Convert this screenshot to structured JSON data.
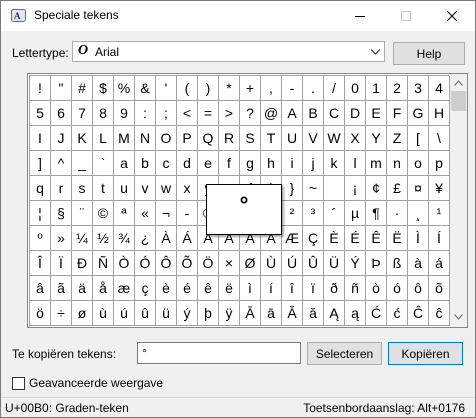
{
  "window": {
    "title": "Speciale tekens",
    "icons": {
      "app": "character-map-icon",
      "minimize": "minimize-icon",
      "maximize": "maximize-icon",
      "close": "close-icon"
    }
  },
  "font": {
    "label": "Lettertype:",
    "value": "Arial",
    "type_icon": "O",
    "help_label": "Help"
  },
  "grid": {
    "rows": [
      [
        "!",
        "\"",
        "#",
        "$",
        "%",
        "&",
        "'",
        "(",
        ")",
        "*",
        "+",
        ",",
        "-",
        ".",
        "/",
        "0",
        "1",
        "2",
        "3",
        "4"
      ],
      [
        "5",
        "6",
        "7",
        "8",
        "9",
        ":",
        ";",
        "<",
        "=",
        ">",
        "?",
        "@",
        "A",
        "B",
        "C",
        "D",
        "E",
        "F",
        "G",
        "H"
      ],
      [
        "I",
        "J",
        "K",
        "L",
        "M",
        "N",
        "O",
        "P",
        "Q",
        "R",
        "S",
        "T",
        "U",
        "V",
        "W",
        "X",
        "Y",
        "Z",
        "[",
        "\\"
      ],
      [
        "]",
        "^",
        "_",
        "`",
        "a",
        "b",
        "c",
        "d",
        "e",
        "f",
        "g",
        "h",
        "i",
        "j",
        "k",
        "l",
        "m",
        "n",
        "o",
        "p"
      ],
      [
        "q",
        "r",
        "s",
        "t",
        "u",
        "v",
        "w",
        "x",
        "y",
        "z",
        "{",
        "|",
        "}",
        "~",
        " ",
        "¡",
        "¢",
        "£",
        "¤",
        "¥"
      ],
      [
        "¦",
        "§",
        "¨",
        "©",
        "ª",
        "«",
        "¬",
        "-",
        "®",
        "¯",
        "°",
        "±",
        "²",
        "³",
        "´",
        "µ",
        "¶",
        "·",
        "¸",
        "¹"
      ],
      [
        "º",
        "»",
        "¼",
        "½",
        "¾",
        "¿",
        "À",
        "Á",
        "Â",
        "Ã",
        "Ä",
        "Å",
        "Æ",
        "Ç",
        "È",
        "É",
        "Ê",
        "Ë",
        "Ì",
        "Í"
      ],
      [
        "Î",
        "Ï",
        "Ð",
        "Ñ",
        "Ò",
        "Ó",
        "Ô",
        "Õ",
        "Ö",
        "×",
        "Ø",
        "Ù",
        "Ú",
        "Û",
        "Ü",
        "Ý",
        "Þ",
        "ß",
        "à",
        "á"
      ],
      [
        "â",
        "ã",
        "ä",
        "å",
        "æ",
        "ç",
        "è",
        "é",
        "ê",
        "ë",
        "ì",
        "í",
        "î",
        "ï",
        "ð",
        "ñ",
        "ò",
        "ó",
        "ô",
        "õ"
      ],
      [
        "ö",
        "÷",
        "ø",
        "ù",
        "ú",
        "û",
        "ü",
        "ý",
        "þ",
        "ÿ",
        "Ā",
        "ā",
        "Ă",
        "ă",
        "Ą",
        "ą",
        "Ć",
        "ć",
        "Ĉ",
        "ĉ"
      ]
    ],
    "zoom_char": "°",
    "selected_cell": {
      "row": 5,
      "col": 10
    }
  },
  "copy": {
    "label": "Te kopiëren tekens:",
    "value": "°",
    "select_label": "Selecteren",
    "copy_label": "Kopiëren"
  },
  "advanced": {
    "label": "Geavanceerde weergave",
    "checked": false
  },
  "status": {
    "left": "U+00B0: Graden-teken",
    "right": "Toetsenbordaanslag: Alt+0176"
  }
}
